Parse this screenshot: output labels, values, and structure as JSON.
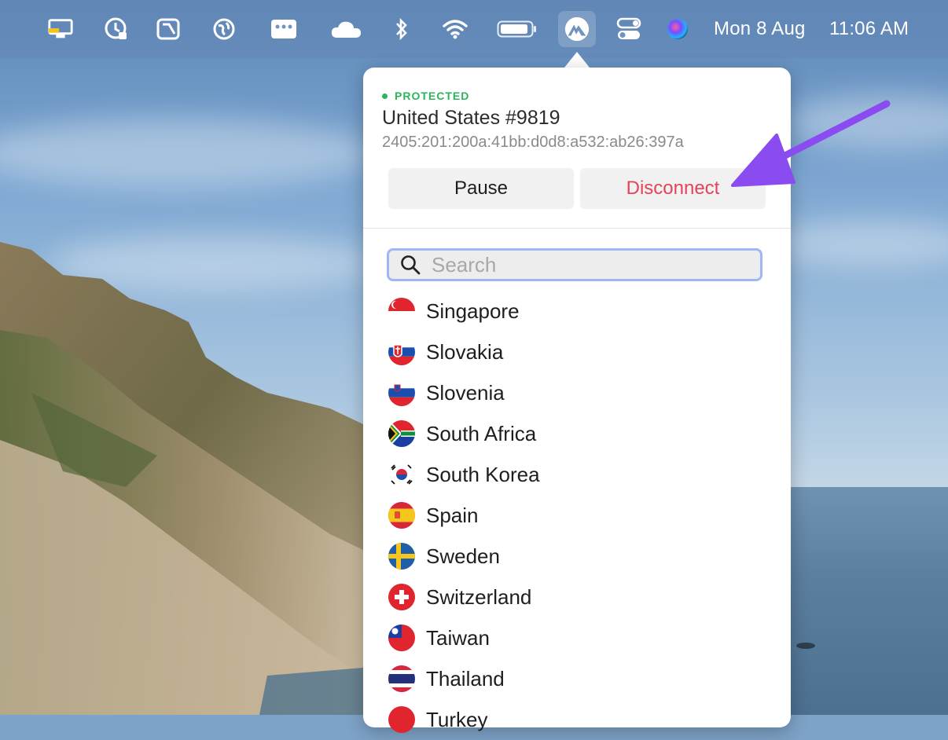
{
  "menubar": {
    "date": "Mon 8 Aug",
    "time": "11:06 AM",
    "icons": [
      "display-icon",
      "time-machine-icon",
      "pen-icon",
      "globe-icon",
      "dots-icon",
      "cloud-icon",
      "bluetooth-icon",
      "wifi-icon",
      "battery-icon",
      "nordvpn-icon",
      "control-center-icon",
      "siri-icon"
    ]
  },
  "vpn": {
    "status": "PROTECTED",
    "server": "United States #9819",
    "ip": "2405:201:200a:41bb:d0d8:a532:ab26:397a",
    "pause_label": "Pause",
    "disconnect_label": "Disconnect",
    "search_placeholder": "Search",
    "countries": [
      "Singapore",
      "Slovakia",
      "Slovenia",
      "South Africa",
      "South Korea",
      "Spain",
      "Sweden",
      "Switzerland",
      "Taiwan",
      "Thailand",
      "Turkey"
    ]
  },
  "colors": {
    "protected_green": "#2bb55b",
    "disconnect_red": "#e8415a",
    "annotation_arrow": "#8a4bf0"
  }
}
